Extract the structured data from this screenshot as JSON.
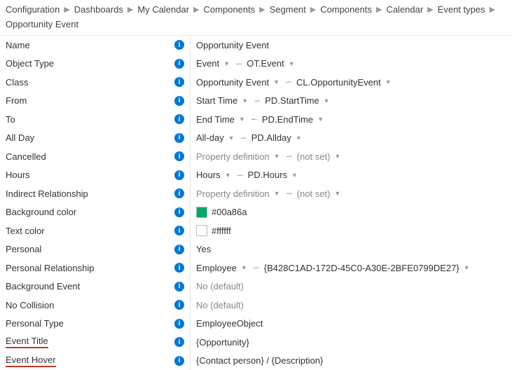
{
  "breadcrumb": [
    "Configuration",
    "Dashboards",
    "My Calendar",
    "Components",
    "Segment",
    "Components",
    "Calendar",
    "Event types",
    "Opportunity Event"
  ],
  "colors": {
    "bg": "#00a86a",
    "text": "#ffffff"
  },
  "rows": {
    "name": {
      "label": "Name",
      "value": "Opportunity Event"
    },
    "objectType": {
      "label": "Object Type",
      "v1": "Event",
      "v2": "OT.Event"
    },
    "class": {
      "label": "Class",
      "v1": "Opportunity Event",
      "v2": "CL.OpportunityEvent"
    },
    "from": {
      "label": "From",
      "v1": "Start Time",
      "v2": "PD.StartTime"
    },
    "to": {
      "label": "To",
      "v1": "End Time",
      "v2": "PD.EndTime"
    },
    "allDay": {
      "label": "All Day",
      "v1": "All-day",
      "v2": "PD.Allday"
    },
    "cancelled": {
      "label": "Cancelled",
      "v1": "Property definition",
      "v2": "(not set)"
    },
    "hours": {
      "label": "Hours",
      "v1": "Hours",
      "v2": "PD.Hours"
    },
    "indirect": {
      "label": "Indirect Relationship",
      "v1": "Property definition",
      "v2": "(not set)"
    },
    "bgColor": {
      "label": "Background color",
      "value": "#00a86a"
    },
    "textColor": {
      "label": "Text color",
      "value": "#ffffff"
    },
    "personal": {
      "label": "Personal",
      "value": "Yes"
    },
    "personalRel": {
      "label": "Personal Relationship",
      "v1": "Employee",
      "v2": "{B428C1AD-172D-45C0-A30E-2BFE0799DE27}"
    },
    "bgEvent": {
      "label": "Background Event",
      "value": "No (default)"
    },
    "noColl": {
      "label": "No Collision",
      "value": "No (default)"
    },
    "pType": {
      "label": "Personal Type",
      "value": "EmployeeObject"
    },
    "eTitle": {
      "label": "Event Title",
      "value": "{Opportunity}"
    },
    "eHover": {
      "label": "Event Hover",
      "value": "{Contact person} / {Description}"
    }
  }
}
